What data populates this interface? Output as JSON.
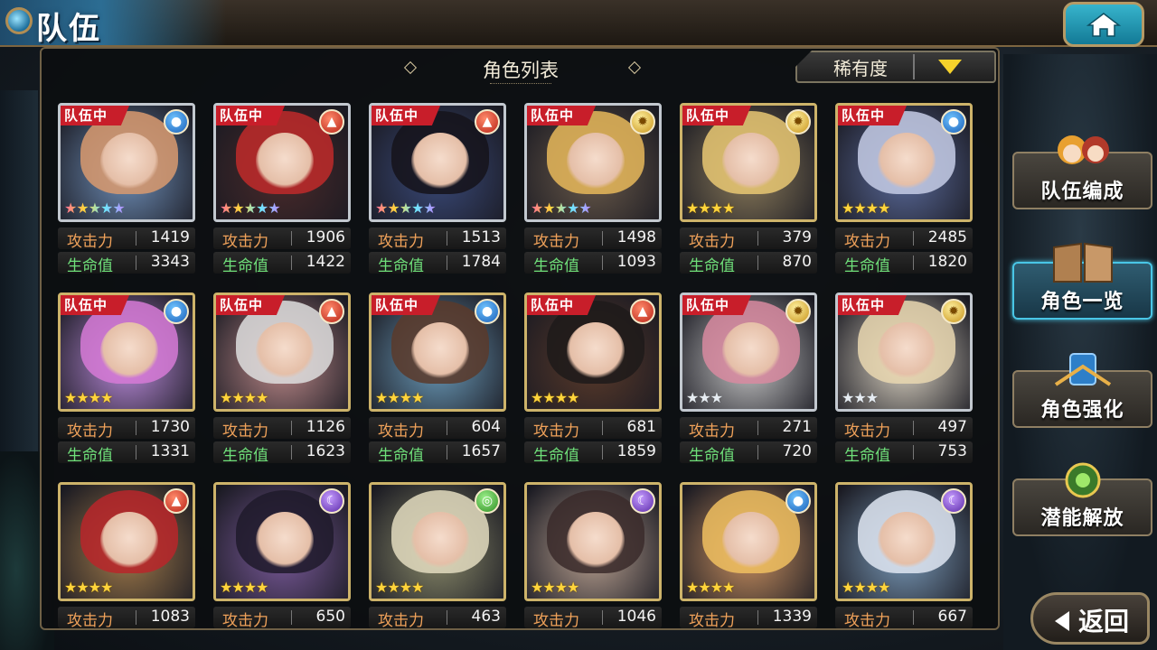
{
  "header": {
    "title": "队伍"
  },
  "panel": {
    "title": "角色列表",
    "sort_label": "稀有度"
  },
  "stat_labels": {
    "attack": "攻击力",
    "hp": "生命值"
  },
  "badge_text": "队伍中",
  "colors": {
    "badge": "#c81e2a",
    "attack_label": "#f0a25a",
    "hp_label": "#6fe07a",
    "sort_arrow": "#f6d22b",
    "active_menu": "#49c6e6"
  },
  "characters": [
    {
      "in_party": true,
      "element": "water",
      "stars": 5,
      "star_style": "rainbow",
      "frame": "silver",
      "hair": "#d99a6e",
      "bg": "#6f8fb8",
      "attack": "1419",
      "hp": "3343"
    },
    {
      "in_party": true,
      "element": "fire",
      "stars": 5,
      "star_style": "rainbow",
      "frame": "silver",
      "hair": "#c02a2a",
      "bg": "#4a2a2a",
      "attack": "1906",
      "hp": "1422"
    },
    {
      "in_party": true,
      "element": "fire",
      "stars": 5,
      "star_style": "rainbow",
      "frame": "silver",
      "hair": "#15131a",
      "bg": "#3a4a7a",
      "attack": "1513",
      "hp": "1784"
    },
    {
      "in_party": true,
      "element": "light",
      "stars": 5,
      "star_style": "rainbow",
      "frame": "silver",
      "hair": "#e8b85a",
      "bg": "#6a5a4a",
      "attack": "1498",
      "hp": "1093"
    },
    {
      "in_party": true,
      "element": "light",
      "stars": 4,
      "star_style": "gold",
      "frame": "gold",
      "hair": "#e9c873",
      "bg": "#8a7a5a",
      "attack": "379",
      "hp": "870"
    },
    {
      "in_party": true,
      "element": "water",
      "stars": 4,
      "star_style": "gold",
      "frame": "gold",
      "hair": "#c6cde6",
      "bg": "#5a6a9a",
      "attack": "2485",
      "hp": "1820"
    },
    {
      "in_party": true,
      "element": "water",
      "stars": 4,
      "star_style": "gold",
      "frame": "gold",
      "hair": "#d67ad6",
      "bg": "#b889d8",
      "attack": "1730",
      "hp": "1331"
    },
    {
      "in_party": true,
      "element": "fire",
      "stars": 4,
      "star_style": "gold",
      "frame": "gold",
      "hair": "#dedede",
      "bg": "#b88",
      "attack": "1126",
      "hp": "1623"
    },
    {
      "in_party": true,
      "element": "water",
      "stars": 4,
      "star_style": "gold",
      "frame": "gold",
      "hair": "#5a3a2a",
      "bg": "#6a9ab8",
      "attack": "604",
      "hp": "1657"
    },
    {
      "in_party": true,
      "element": "fire",
      "stars": 4,
      "star_style": "gold",
      "frame": "gold",
      "hair": "#1d1a1a",
      "bg": "#5a3a2a",
      "attack": "681",
      "hp": "1859"
    },
    {
      "in_party": true,
      "element": "light",
      "stars": 3,
      "star_style": "silver",
      "frame": "silver",
      "hair": "#d88aa0",
      "bg": "#c4c4c4",
      "attack": "271",
      "hp": "720"
    },
    {
      "in_party": true,
      "element": "light",
      "stars": 3,
      "star_style": "silver",
      "frame": "silver",
      "hair": "#e9d7b0",
      "bg": "#d8d0c0",
      "attack": "497",
      "hp": "753"
    },
    {
      "in_party": false,
      "element": "fire",
      "stars": 4,
      "star_style": "gold",
      "frame": "gold",
      "hair": "#b8262a",
      "bg": "#a07a4a",
      "attack": "1083",
      "hp": ""
    },
    {
      "in_party": false,
      "element": "dark",
      "stars": 4,
      "star_style": "gold",
      "frame": "gold",
      "hair": "#1f1a2a",
      "bg": "#7a5a9a",
      "attack": "650",
      "hp": ""
    },
    {
      "in_party": false,
      "element": "wind",
      "stars": 4,
      "star_style": "gold",
      "frame": "gold",
      "hair": "#e3dcc0",
      "bg": "#8a8a6a",
      "attack": "463",
      "hp": ""
    },
    {
      "in_party": false,
      "element": "dark",
      "stars": 4,
      "star_style": "gold",
      "frame": "gold",
      "hair": "#3a2a2a",
      "bg": "#b8a090",
      "attack": "1046",
      "hp": ""
    },
    {
      "in_party": false,
      "element": "water",
      "stars": 4,
      "star_style": "gold",
      "frame": "gold",
      "hair": "#f0c060",
      "bg": "#c89060",
      "attack": "1339",
      "hp": ""
    },
    {
      "in_party": false,
      "element": "dark",
      "stars": 4,
      "star_style": "gold",
      "frame": "gold",
      "hair": "#dfe6f2",
      "bg": "#7a9ab8",
      "attack": "667",
      "hp": ""
    }
  ],
  "side_menu": [
    {
      "label": "队伍编成",
      "icon": "party-icon",
      "active": false
    },
    {
      "label": "角色一览",
      "icon": "book-icon",
      "active": true
    },
    {
      "label": "角色强化",
      "icon": "enhance-icon",
      "active": false
    },
    {
      "label": "潜能解放",
      "icon": "potential-icon",
      "active": false
    }
  ],
  "back_label": "返回"
}
